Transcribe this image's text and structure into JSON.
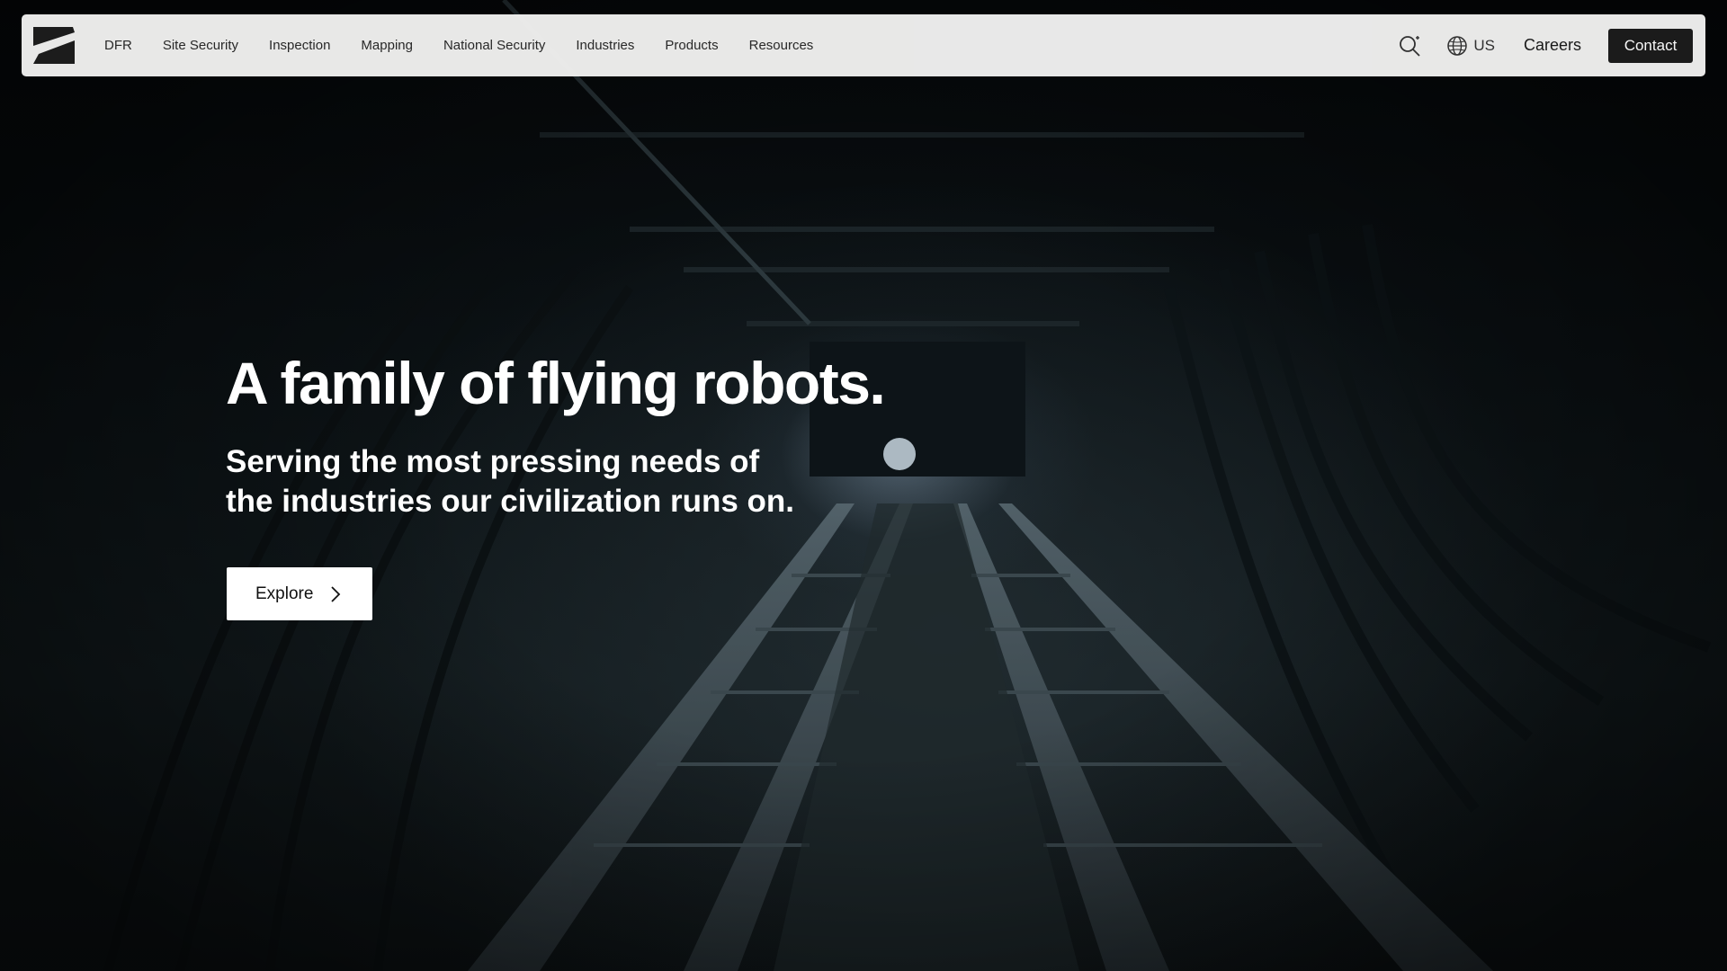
{
  "nav": {
    "links": [
      {
        "label": "DFR"
      },
      {
        "label": "Site Security"
      },
      {
        "label": "Inspection"
      },
      {
        "label": "Mapping"
      },
      {
        "label": "National Security"
      },
      {
        "label": "Industries"
      },
      {
        "label": "Products"
      },
      {
        "label": "Resources"
      }
    ],
    "locale": "US",
    "careers_label": "Careers",
    "contact_label": "Contact",
    "icons": [
      "logo-icon",
      "search-icon",
      "globe-icon"
    ]
  },
  "hero": {
    "headline": "A family of flying robots.",
    "subheadline": "Serving the most pressing needs of the industries our civilization runs on.",
    "cta_label": "Explore",
    "cta_icon": "chevron-right-icon"
  },
  "colors": {
    "nav_background": "#f0f0ef",
    "contact_background": "#1c1c1c",
    "hero_text": "#ffffff",
    "cta_background": "#ffffff"
  }
}
